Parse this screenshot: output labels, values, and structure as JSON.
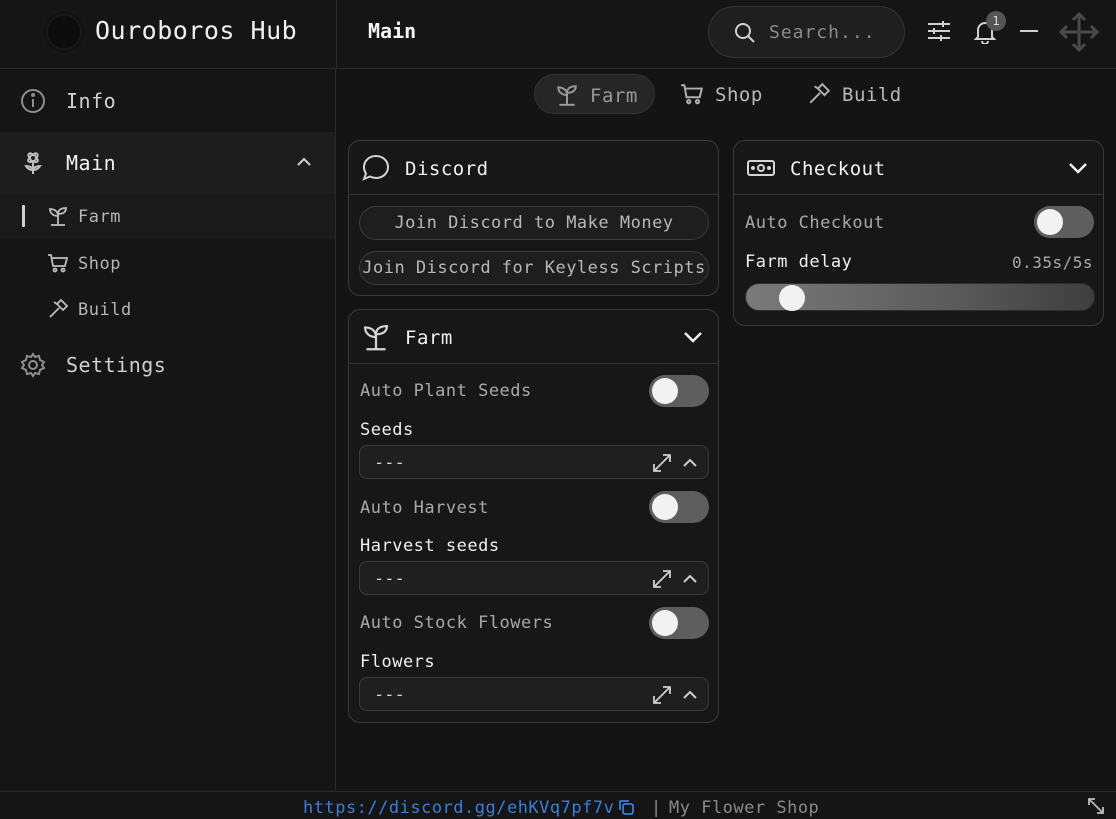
{
  "app": {
    "title": "Ouroboros Hub"
  },
  "header": {
    "page_title": "Main",
    "search_placeholder": "Search...",
    "notification_count": "1"
  },
  "sidebar": {
    "items": [
      {
        "label": "Info",
        "icon": "info-icon"
      },
      {
        "label": "Main",
        "icon": "flower-icon"
      },
      {
        "label": "Settings",
        "icon": "gear-icon"
      }
    ],
    "subitems": [
      {
        "label": "Farm",
        "icon": "sprout-icon"
      },
      {
        "label": "Shop",
        "icon": "cart-icon"
      },
      {
        "label": "Build",
        "icon": "hammer-icon"
      }
    ]
  },
  "tabs": [
    {
      "label": "Farm",
      "icon": "sprout-icon"
    },
    {
      "label": "Shop",
      "icon": "cart-icon"
    },
    {
      "label": "Build",
      "icon": "hammer-icon"
    }
  ],
  "discord_panel": {
    "title": "Discord",
    "buttons": [
      "Join Discord to Make Money",
      "Join Discord for Keyless Scripts"
    ]
  },
  "farm_panel": {
    "title": "Farm",
    "auto_plant_label": "Auto Plant Seeds",
    "seeds_label": "Seeds",
    "seeds_value": "---",
    "auto_harvest_label": "Auto Harvest",
    "harvest_seeds_label": "Harvest seeds",
    "harvest_seeds_value": "---",
    "auto_stock_label": "Auto Stock Flowers",
    "flowers_label": "Flowers",
    "flowers_value": "---"
  },
  "checkout_panel": {
    "title": "Checkout",
    "auto_checkout_label": "Auto Checkout",
    "farm_delay_label": "Farm delay",
    "farm_delay_value": "0.35s/5s",
    "farm_delay_fraction": 0.07
  },
  "footer": {
    "link": "https://discord.gg/ehKVq7pf7v",
    "separator": "|",
    "shop_name": "My Flower Shop"
  },
  "toggles": {
    "auto_plant": false,
    "auto_harvest": false,
    "auto_stock": false,
    "auto_checkout": false
  }
}
